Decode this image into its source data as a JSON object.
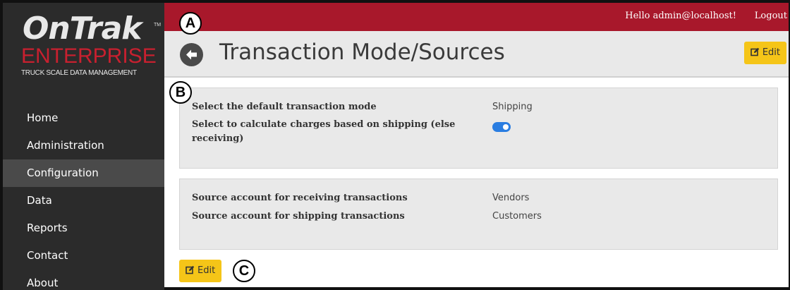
{
  "sidebar": {
    "logo": {
      "main": "OnTrak",
      "tm": "TM",
      "line2": "ENTERPRISE",
      "tagline": "TRUCK SCALE DATA MANAGEMENT"
    },
    "items": [
      {
        "label": "Home"
      },
      {
        "label": "Administration"
      },
      {
        "label": "Configuration",
        "active": true
      },
      {
        "label": "Data"
      },
      {
        "label": "Reports"
      },
      {
        "label": "Contact"
      },
      {
        "label": "About"
      }
    ]
  },
  "topbar": {
    "greeting": "Hello admin@localhost!",
    "logout": "Logout",
    "color": "#a8182b"
  },
  "header": {
    "title": "Transaction Mode/Sources",
    "edit_label": "Edit"
  },
  "callouts": {
    "a": "A",
    "b": "B",
    "c": "C"
  },
  "panel1": {
    "rows": [
      {
        "label": "Select the default transaction mode",
        "value": "Shipping"
      },
      {
        "label": "Select to calculate charges based on shipping (else receiving)",
        "toggle": true
      }
    ]
  },
  "panel2": {
    "rows": [
      {
        "label": "Source account for receiving transactions",
        "value": "Vendors"
      },
      {
        "label": "Source account for shipping transactions",
        "value": "Customers"
      }
    ]
  },
  "footer": {
    "edit_label": "Edit"
  },
  "colors": {
    "accent": "#f5c518",
    "toggle": "#2a7de1",
    "sidebar": "#2b2b2b"
  },
  "icons": {
    "back": "arrow-left-circle-icon",
    "edit": "pencil-square-icon"
  }
}
